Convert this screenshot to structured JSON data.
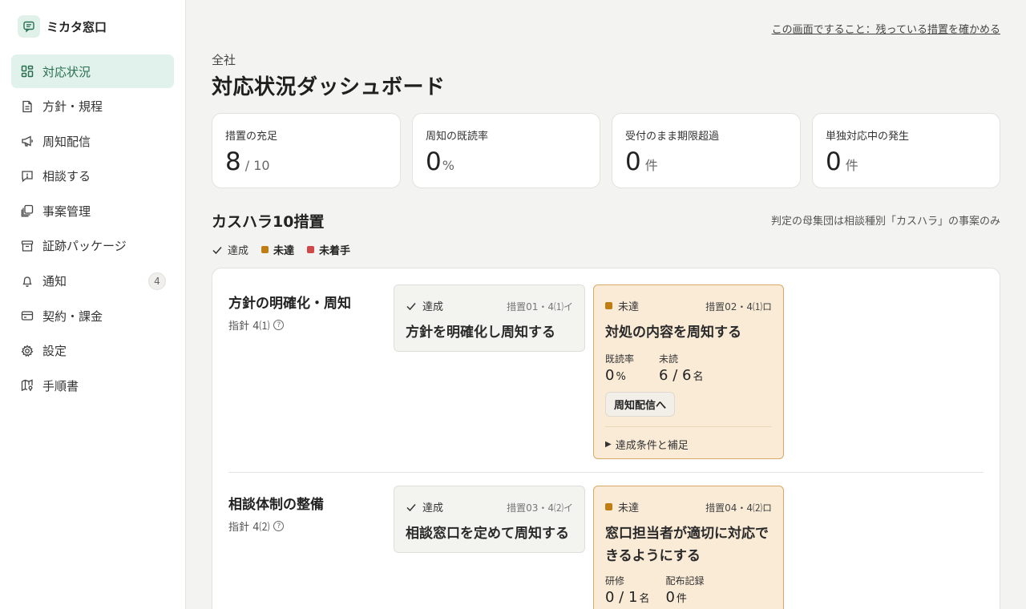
{
  "app": {
    "name": "ミカタ窓口"
  },
  "sidebar": {
    "items": [
      {
        "label": "対応状況",
        "icon": "dashboard-icon",
        "active": true
      },
      {
        "label": "方針・規程",
        "icon": "document-icon"
      },
      {
        "label": "周知配信",
        "icon": "megaphone-icon"
      },
      {
        "label": "相談する",
        "icon": "message-alert-icon"
      },
      {
        "label": "事案管理",
        "icon": "folders-icon"
      },
      {
        "label": "証跡パッケージ",
        "icon": "archive-icon"
      },
      {
        "label": "通知",
        "icon": "bell-icon",
        "badge": "4"
      },
      {
        "label": "契約・課金",
        "icon": "card-icon"
      },
      {
        "label": "設定",
        "icon": "gear-icon"
      },
      {
        "label": "手順書",
        "icon": "map-icon"
      }
    ]
  },
  "header": {
    "help_link": "この画面ですること：残っている措置を確かめる",
    "kicker": "全社",
    "title": "対応状況ダッシュボード"
  },
  "stats": [
    {
      "label": "措置の充足",
      "value": "8",
      "unit": "/ 10"
    },
    {
      "label": "周知の既読率",
      "value": "0",
      "unit": "%"
    },
    {
      "label": "受付のまま期限超過",
      "value": "0",
      "unit": "件"
    },
    {
      "label": "単独対応中の発生",
      "value": "0",
      "unit": "件"
    }
  ],
  "section": {
    "title": "カスハラ10措置",
    "note": "判定の母集団は相談種別「カスハラ」の事案のみ",
    "legend": [
      {
        "label": "達成",
        "marker": "check-icon"
      },
      {
        "label": "未達",
        "color": "#c07d12"
      },
      {
        "label": "未着手",
        "color": "#d04848"
      }
    ]
  },
  "colors": {
    "accent": "#2a6e52",
    "todo_dot": "#c07d12",
    "todo_bg": "#faebd7"
  },
  "rows": [
    {
      "name": "方針の明確化・周知",
      "sub": "指針 4⑴",
      "cards": [
        {
          "status": "達成",
          "code": "措置01・4⑴イ",
          "title": "方針を明確化し周知する"
        },
        {
          "status": "未達",
          "code": "措置02・4⑴ロ",
          "title": "対処の内容を周知する",
          "m1_label": "既読率",
          "m1_value": "0",
          "m1_unit": "%",
          "m2_label": "未読",
          "m2_value": "6 / 6",
          "m2_unit": "名",
          "button": "周知配信へ",
          "details": "達成条件と補足"
        }
      ]
    },
    {
      "name": "相談体制の整備",
      "sub": "指針 4⑵",
      "cards": [
        {
          "status": "達成",
          "code": "措置03・4⑵イ",
          "title": "相談窓口を定めて周知する"
        },
        {
          "status": "未達",
          "code": "措置04・4⑵ロ",
          "title": "窓口担当者が適切に対応できるようにする",
          "m1_label": "研修",
          "m1_value": "0 / 1",
          "m1_unit": "名",
          "m2_label": "配布記録",
          "m2_value": "0",
          "m2_unit": "件"
        }
      ]
    }
  ]
}
